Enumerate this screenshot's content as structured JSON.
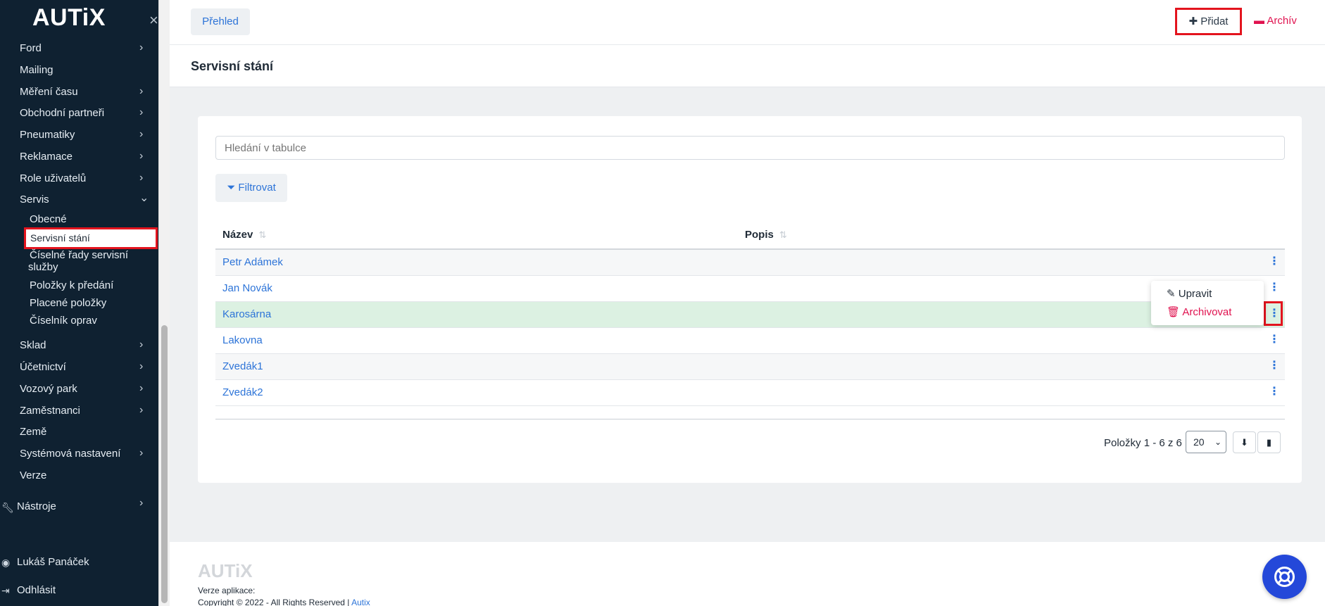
{
  "app": {
    "logo": "AUTiX",
    "close_icon": "×"
  },
  "sidebar": {
    "items": [
      {
        "label": "Ford",
        "chevron": "›"
      },
      {
        "label": "Mailing"
      },
      {
        "label": "Měření času",
        "chevron": "›"
      },
      {
        "label": "Obchodní partneři",
        "chevron": "›"
      },
      {
        "label": "Pneumatiky",
        "chevron": "›"
      },
      {
        "label": "Reklamace",
        "chevron": "›"
      },
      {
        "label": "Role uživatelů",
        "chevron": "›"
      },
      {
        "label": "Servis",
        "chevron": "⌄"
      },
      {
        "label": "Sklad",
        "chevron": "›"
      },
      {
        "label": "Účetnictví",
        "chevron": "›"
      },
      {
        "label": "Vozový park",
        "chevron": "›"
      },
      {
        "label": "Zaměstnanci",
        "chevron": "›"
      },
      {
        "label": "Země"
      },
      {
        "label": "Systémová nastavení",
        "chevron": "›"
      },
      {
        "label": "Verze"
      }
    ],
    "servis_sub": [
      {
        "label": "Obecné"
      },
      {
        "label": "Servisní stání"
      },
      {
        "label": "Číselné řady servisní"
      },
      {
        "label": "služby"
      },
      {
        "label": "Položky k předání"
      },
      {
        "label": "Placené položky"
      },
      {
        "label": "Číselník oprav"
      }
    ],
    "tools": {
      "label": "Nástroje",
      "chevron": "›"
    },
    "user": {
      "label": "Lukáš Panáček"
    },
    "logout": {
      "label": "Odhlásit"
    }
  },
  "header": {
    "tab_prehled": "Přehled",
    "add_label": "Přidat",
    "archive_label": "Archív"
  },
  "page": {
    "title": "Servisní stání"
  },
  "table": {
    "search_placeholder": "Hledání v tabulce",
    "filter_label": "Filtrovat",
    "columns": [
      "Název",
      "Popis"
    ],
    "rows": [
      {
        "name": "Petr Adámek"
      },
      {
        "name": "Jan Novák"
      },
      {
        "name": "Karosárna"
      },
      {
        "name": "Lakovna"
      },
      {
        "name": "Zvedák1"
      },
      {
        "name": "Zvedák2"
      }
    ],
    "selected_row": "Karosárna",
    "pagination_text": "Položky 1 - 6 z 6",
    "page_size": "20"
  },
  "dropdown": {
    "edit": "Upravit",
    "archive": "Archivovat"
  },
  "footer": {
    "logo": "AUTiX",
    "version_label": "Verze aplikace:",
    "copyright": "Copyright © 2022 - All Rights Reserved |",
    "link": "Autix"
  },
  "colors": {
    "sidebar_bg": "#0f2131",
    "accent_blue": "#2d74d8",
    "archive_pink": "#e0124f",
    "highlight_red": "#e3141e",
    "selected_row": "#dcf1e2"
  }
}
